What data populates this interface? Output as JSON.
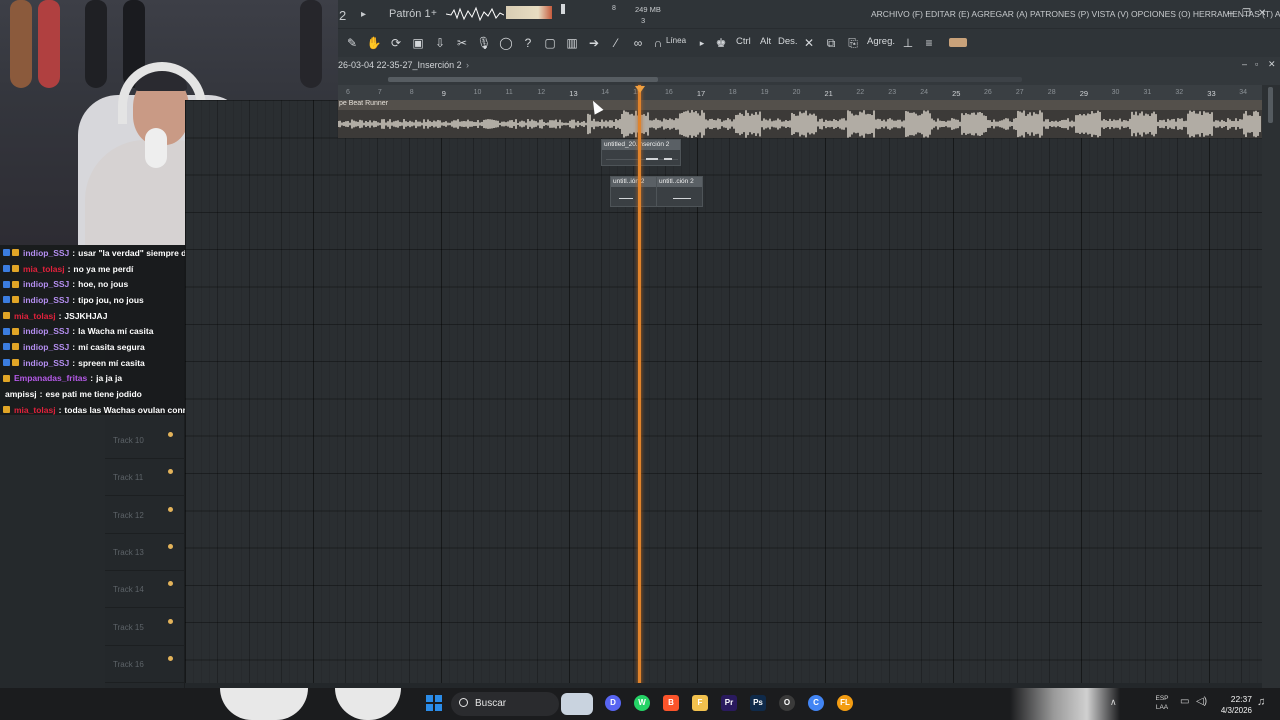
{
  "toolbar": {
    "pattern_label": "Patrón 1",
    "memory": "249 MB",
    "cpu_top": "8",
    "voices": "3",
    "tempo_small": "2",
    "menu_text": "ARCHIVO (F) EDITAR (E) AGREGAR (A) PATRONES (P) VISTA (V) OPCIONES (O) HERRAMIENTAS (T) AYUDA",
    "snap_label": "Línea",
    "key_ctrl": "Ctrl",
    "key_alt": "Alt",
    "key_des": "Des.",
    "agreg_label": "Agreg."
  },
  "playlist": {
    "title": "26-03-04 22-35-27_Inserción 2",
    "ruler_numbers": [
      "6",
      "7",
      "8",
      "9",
      "10",
      "11",
      "12",
      "13",
      "14",
      "15",
      "16",
      "17",
      "18",
      "19",
      "20",
      "21",
      "22",
      "23",
      "24",
      "25",
      "26",
      "27",
      "28",
      "29",
      "30",
      "31",
      "32",
      "33",
      "34"
    ],
    "audio_clip_name": "pe Beat Runner",
    "pattern_clips": [
      "untitled_20..nserción 2",
      "untitl..ión 2",
      "untitl..ción 2"
    ],
    "tracks": [
      {
        "name": "Track 10"
      },
      {
        "name": "Track 11"
      },
      {
        "name": "Track 12"
      },
      {
        "name": "Track 13"
      },
      {
        "name": "Track 14"
      },
      {
        "name": "Track 15"
      },
      {
        "name": "Track 16"
      }
    ]
  },
  "chat": {
    "messages": [
      {
        "user": "indiop_SSJ",
        "msg": "usar \"la verdad\" siempre de muletilla",
        "color": "#b48ef0",
        "badges": [
          "blue",
          "gold"
        ]
      },
      {
        "user": "mia_tolasj",
        "msg": "no ya me perdí",
        "color": "#e0213b",
        "badges": [
          "blue",
          "gold"
        ]
      },
      {
        "user": "indiop_SSJ",
        "msg": "hoe, no jous",
        "color": "#b48ef0",
        "badges": [
          "blue",
          "gold"
        ]
      },
      {
        "user": "indiop_SSJ",
        "msg": "tipo jou, no jous",
        "color": "#b48ef0",
        "badges": [
          "blue",
          "gold"
        ]
      },
      {
        "user": "mia_tolasj",
        "msg": "JSJKHJAJ",
        "color": "#e0213b",
        "badges": [
          "gold"
        ]
      },
      {
        "user": "indiop_SSJ",
        "msg": "la Wacha mí casita",
        "color": "#b48ef0",
        "badges": [
          "blue",
          "gold"
        ]
      },
      {
        "user": "indiop_SSJ",
        "msg": "mí casita segura",
        "color": "#b48ef0",
        "badges": [
          "blue",
          "gold"
        ]
      },
      {
        "user": "indiop_SSJ",
        "msg": "spreen mí casita",
        "color": "#b48ef0",
        "badges": [
          "blue",
          "gold"
        ]
      },
      {
        "user": "Empanadas_fritas",
        "msg": "ja ja ja",
        "color": "#b55ae8",
        "badges": [
          "gold"
        ]
      },
      {
        "user": "ampissj",
        "msg": "ese pati me tiene jodido",
        "color": "#ffffff",
        "badges": []
      },
      {
        "user": "mia_tolasj",
        "msg": "todas las Wachas ovulan conmigo",
        "color": "#e0213b",
        "badges": [
          "gold"
        ]
      }
    ]
  },
  "taskbar": {
    "search_label": "Buscar",
    "time": "22:37",
    "date": "4/3/2026",
    "lang_line1": "ESP",
    "lang_line2": "LAA",
    "apps": [
      {
        "name": "discord-icon",
        "color": "#5865f2",
        "glyph": "D"
      },
      {
        "name": "whatsapp-icon",
        "color": "#25d366",
        "glyph": "W"
      },
      {
        "name": "brave-icon",
        "color": "#fb542b",
        "glyph": "B"
      },
      {
        "name": "file-explorer-icon",
        "color": "#f2c14e",
        "glyph": "F"
      },
      {
        "name": "premiere-icon",
        "color": "#2a1a5e",
        "glyph": "Pr"
      },
      {
        "name": "photoshop-icon",
        "color": "#0f2a4a",
        "glyph": "Ps"
      },
      {
        "name": "obs-icon",
        "color": "#3a3a3a",
        "glyph": "O"
      },
      {
        "name": "chrome-icon",
        "color": "#4285f4",
        "glyph": "C"
      },
      {
        "name": "fl-studio-icon",
        "color": "#f39c12",
        "glyph": "FL"
      }
    ]
  }
}
